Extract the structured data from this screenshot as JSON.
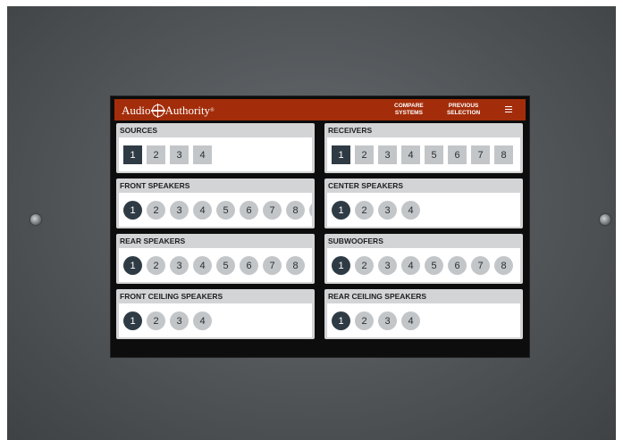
{
  "header": {
    "logo_left": "Audio",
    "logo_right": "Authority",
    "logo_mark": "®",
    "compare_line1": "COMPARE",
    "compare_line2": "SYSTEMS",
    "previous_line1": "PREVIOUS",
    "previous_line2": "SELECTION",
    "menu_icon": "hamburger-menu-icon"
  },
  "colors": {
    "header_bg": "#a32d0a",
    "selected": "#2f3b44",
    "unselected": "#c3c6c9",
    "card_bg": "#d2d4d6"
  },
  "sections": [
    {
      "id": "sources",
      "title": "SOURCES",
      "shape": "square",
      "items": [
        "1",
        "2",
        "3",
        "4"
      ],
      "selected": "1"
    },
    {
      "id": "receivers",
      "title": "RECEIVERS",
      "shape": "square",
      "items": [
        "1",
        "2",
        "3",
        "4",
        "5",
        "6",
        "7",
        "8"
      ],
      "selected": "1"
    },
    {
      "id": "front-speakers",
      "title": "FRONT SPEAKERS",
      "shape": "circle",
      "items": [
        "1",
        "2",
        "3",
        "4",
        "5",
        "6",
        "7",
        "8",
        ""
      ],
      "selected": "1"
    },
    {
      "id": "center-speakers",
      "title": "CENTER SPEAKERS",
      "shape": "circle",
      "items": [
        "1",
        "2",
        "3",
        "4"
      ],
      "selected": "1"
    },
    {
      "id": "rear-speakers",
      "title": "REAR SPEAKERS",
      "shape": "circle",
      "items": [
        "1",
        "2",
        "3",
        "4",
        "5",
        "6",
        "7",
        "8"
      ],
      "selected": "1"
    },
    {
      "id": "subwoofers",
      "title": "SUBWOOFERS",
      "shape": "circle",
      "items": [
        "1",
        "2",
        "3",
        "4",
        "5",
        "6",
        "7",
        "8"
      ],
      "selected": "1"
    },
    {
      "id": "front-ceiling-speakers",
      "title": "FRONT CEILING SPEAKERS",
      "shape": "circle",
      "items": [
        "1",
        "2",
        "3",
        "4"
      ],
      "selected": "1"
    },
    {
      "id": "rear-ceiling-speakers",
      "title": "REAR CEILING SPEAKERS",
      "shape": "circle",
      "items": [
        "1",
        "2",
        "3",
        "4"
      ],
      "selected": "1"
    }
  ]
}
